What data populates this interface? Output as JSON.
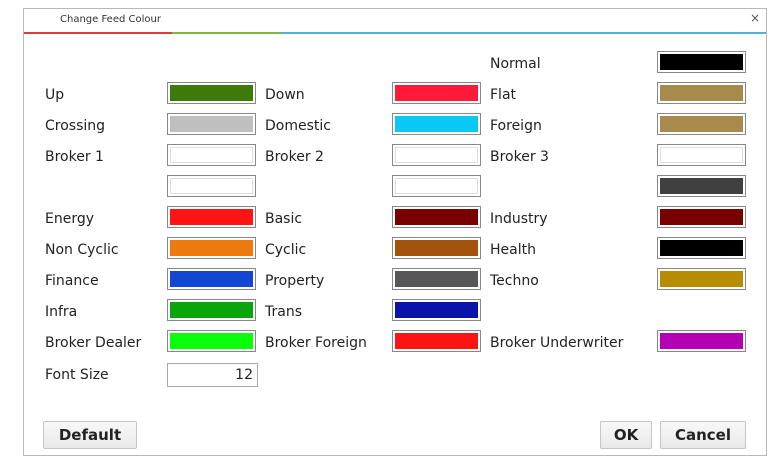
{
  "dialog": {
    "title": "Change Feed Colour",
    "close_label": "×"
  },
  "labels": {
    "normal": "Normal",
    "up": "Up",
    "down": "Down",
    "flat": "Flat",
    "crossing": "Crossing",
    "domestic": "Domestic",
    "foreign": "Foreign",
    "broker1": "Broker 1",
    "broker2": "Broker 2",
    "broker3": "Broker 3",
    "energy": "Energy",
    "basic": "Basic",
    "industry": "Industry",
    "non_cyclic": "Non Cyclic",
    "cyclic": "Cyclic",
    "health": "Health",
    "finance": "Finance",
    "property": "Property",
    "techno": "Techno",
    "infra": "Infra",
    "trans": "Trans",
    "broker_dealer": "Broker Dealer",
    "broker_foreign": "Broker Foreign",
    "broker_underwriter": "Broker Underwriter",
    "font_size": "Font Size"
  },
  "colors": {
    "normal": "#000000",
    "up": "#3e7a0a",
    "down": "#ff1a3a",
    "flat": "#a88a4c",
    "crossing": "#bfbfbf",
    "domestic": "#0ac8f5",
    "foreign": "#a88a4c",
    "broker1": "#ffffff",
    "broker2": "#ffffff",
    "broker3": "#ffffff",
    "extra1": "#ffffff",
    "extra2": "#ffffff",
    "extra3": "#404040",
    "energy": "#ff1414",
    "basic": "#780000",
    "industry": "#780000",
    "non_cyclic": "#ec7a0e",
    "cyclic": "#a3540a",
    "health": "#000000",
    "finance": "#1446d4",
    "property": "#575757",
    "techno": "#b88c00",
    "infra": "#0aa50a",
    "trans": "#0a14a8",
    "broker_dealer": "#0aff0a",
    "broker_foreign": "#ff1414",
    "broker_underwriter": "#b400b4"
  },
  "font_size_value": "12",
  "buttons": {
    "default": "Default",
    "ok": "OK",
    "cancel": "Cancel"
  }
}
